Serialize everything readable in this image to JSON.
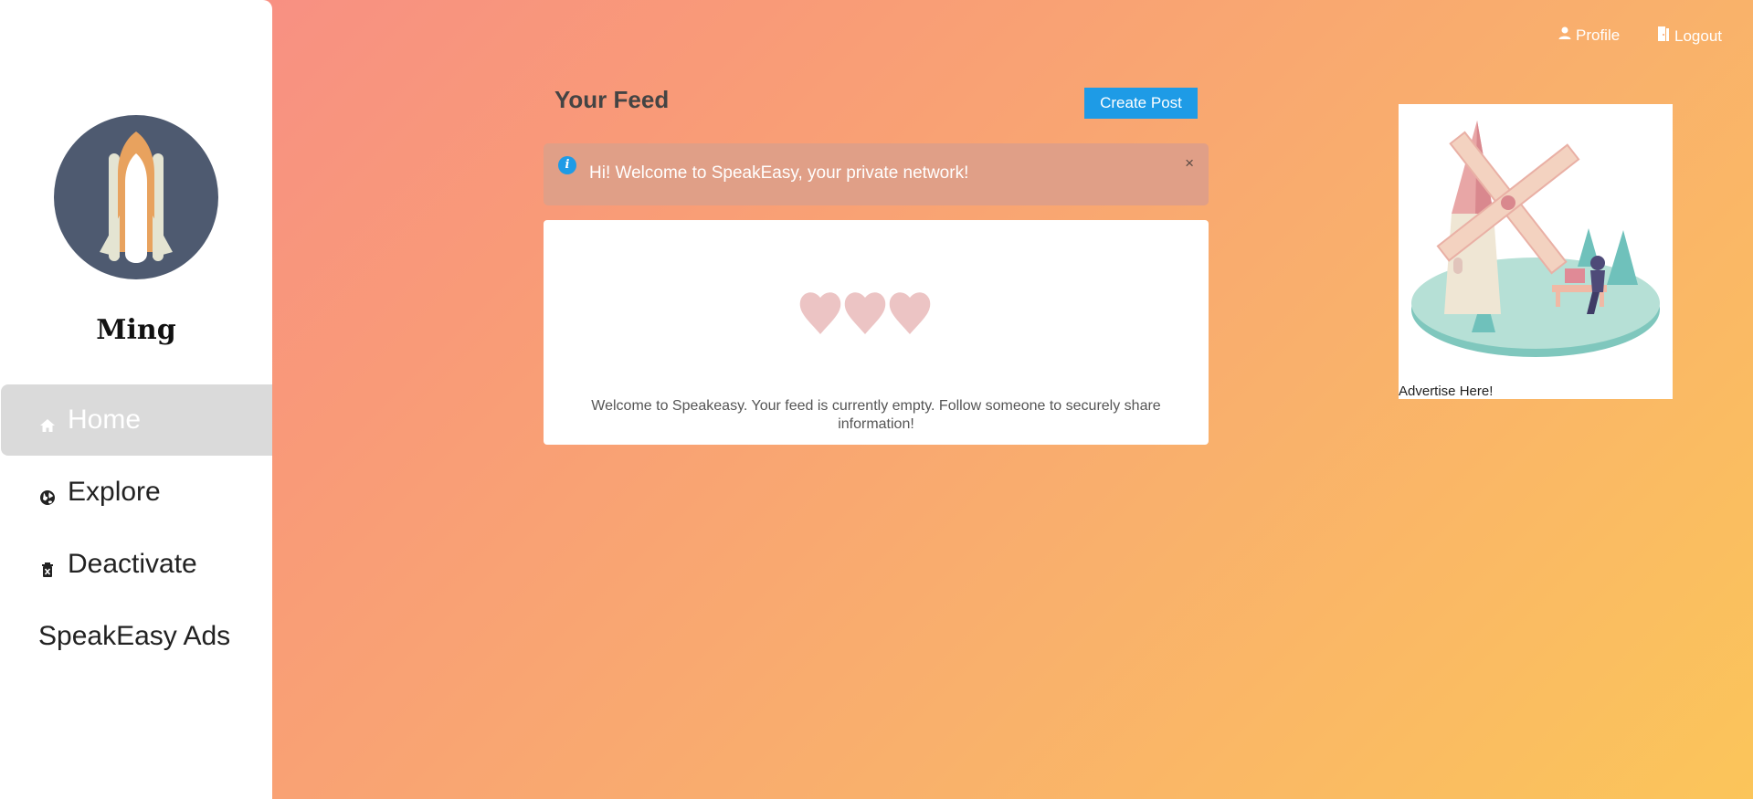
{
  "user": {
    "name": "Ming"
  },
  "sidebar": {
    "items": [
      {
        "label": "Home",
        "icon": "home-icon",
        "active": true
      },
      {
        "label": "Explore",
        "icon": "globe-icon",
        "active": false
      },
      {
        "label": "Deactivate",
        "icon": "delete-icon",
        "active": false
      },
      {
        "label": "SpeakEasy Ads",
        "icon": "",
        "active": false
      }
    ]
  },
  "topnav": {
    "profile_label": "Profile",
    "logout_label": "Logout"
  },
  "feed": {
    "title": "Your Feed",
    "create_label": "Create Post",
    "alert_text": "Hi! Welcome to SpeakEasy, your private network!",
    "alert_close": "×",
    "empty_text": "Welcome to Speakeasy. Your feed is currently empty. Follow someone to securely share information!"
  },
  "ad": {
    "label": "Advertise Here!"
  },
  "colors": {
    "accent": "#1e9be6",
    "avatar_bg": "#4e5a70",
    "alert_bg": "#e09f87",
    "heart": "#ecc4c4"
  }
}
